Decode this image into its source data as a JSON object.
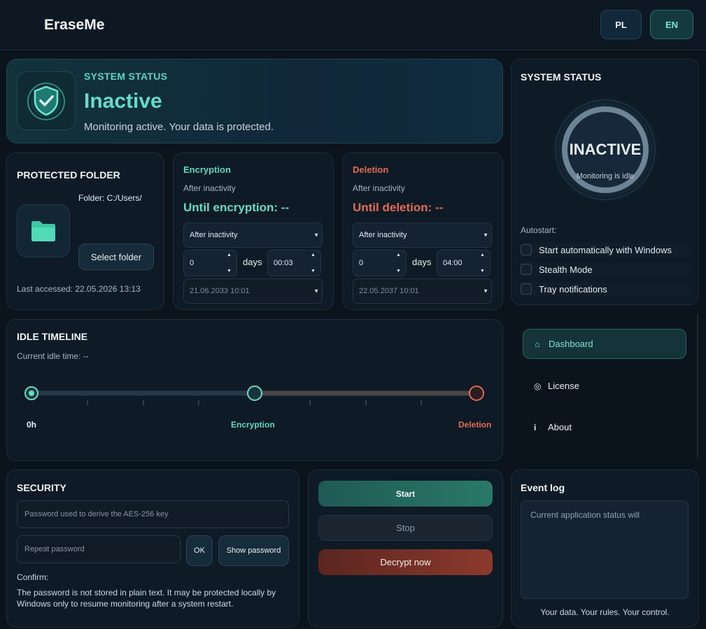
{
  "header": {
    "title": "EraseMe",
    "lang_pl": "PL",
    "lang_en": "EN"
  },
  "banner": {
    "eyebrow": "SYSTEM STATUS",
    "status": "Inactive",
    "subtitle": "Monitoring active. Your data is protected."
  },
  "folder": {
    "title": "PROTECTED FOLDER",
    "path": "Folder: C:/Users/",
    "select_label": "Select folder",
    "last_accessed": "Last accessed: 22.05.2026 13:13"
  },
  "encryption": {
    "title": "Encryption",
    "subtitle": "After inactivity",
    "countdown": "Until encryption: --",
    "mode": "After inactivity",
    "days": "0",
    "days_label": "days",
    "time": "00:03",
    "date": "21.06.2033 10:01"
  },
  "deletion": {
    "title": "Deletion",
    "subtitle": "After inactivity",
    "countdown": "Until deletion: --",
    "mode": "After inactivity",
    "days": "0",
    "days_label": "days",
    "time": "04:00",
    "date": "22.05.2037 10:01"
  },
  "status_panel": {
    "title": "SYSTEM STATUS",
    "ring_label": "INACTIVE",
    "ring_sub": "Monitoring is idle",
    "autostart_label": "Autostart:",
    "options": [
      {
        "label": "Start automatically with Windows",
        "checked": false
      },
      {
        "label": "Stealth Mode",
        "checked": false
      },
      {
        "label": "Tray notifications",
        "checked": false
      }
    ]
  },
  "nav": {
    "items": [
      {
        "label": "Dashboard",
        "icon": "home-icon",
        "glyph": "⌂",
        "active": true
      },
      {
        "label": "License",
        "icon": "license-icon",
        "glyph": "◎",
        "active": false
      },
      {
        "label": "About",
        "icon": "info-icon",
        "glyph": "i",
        "active": false
      }
    ]
  },
  "timeline": {
    "title": "IDLE TIMELINE",
    "current": "Current idle time: --",
    "start_label": "0h",
    "encryption_label": "Encryption",
    "deletion_label": "Deletion"
  },
  "security": {
    "title": "SECURITY",
    "password_placeholder": "Password used to derive the AES-256 key",
    "repeat_placeholder": "Repeat password",
    "ok_label": "OK",
    "show_label": "Show password",
    "confirm_label": "Confirm:",
    "note": "The password is not stored in plain text. It may be protected locally by Windows only to resume monitoring after a system restart."
  },
  "actions": {
    "start": "Start",
    "stop": "Stop",
    "decrypt": "Decrypt now"
  },
  "log": {
    "title": "Event log",
    "text": "Current application status will",
    "footer": "Your data. Your rules. Your control."
  },
  "colors": {
    "accent": "#66dcc8",
    "danger": "#e46a55",
    "background": "#0b141d"
  }
}
